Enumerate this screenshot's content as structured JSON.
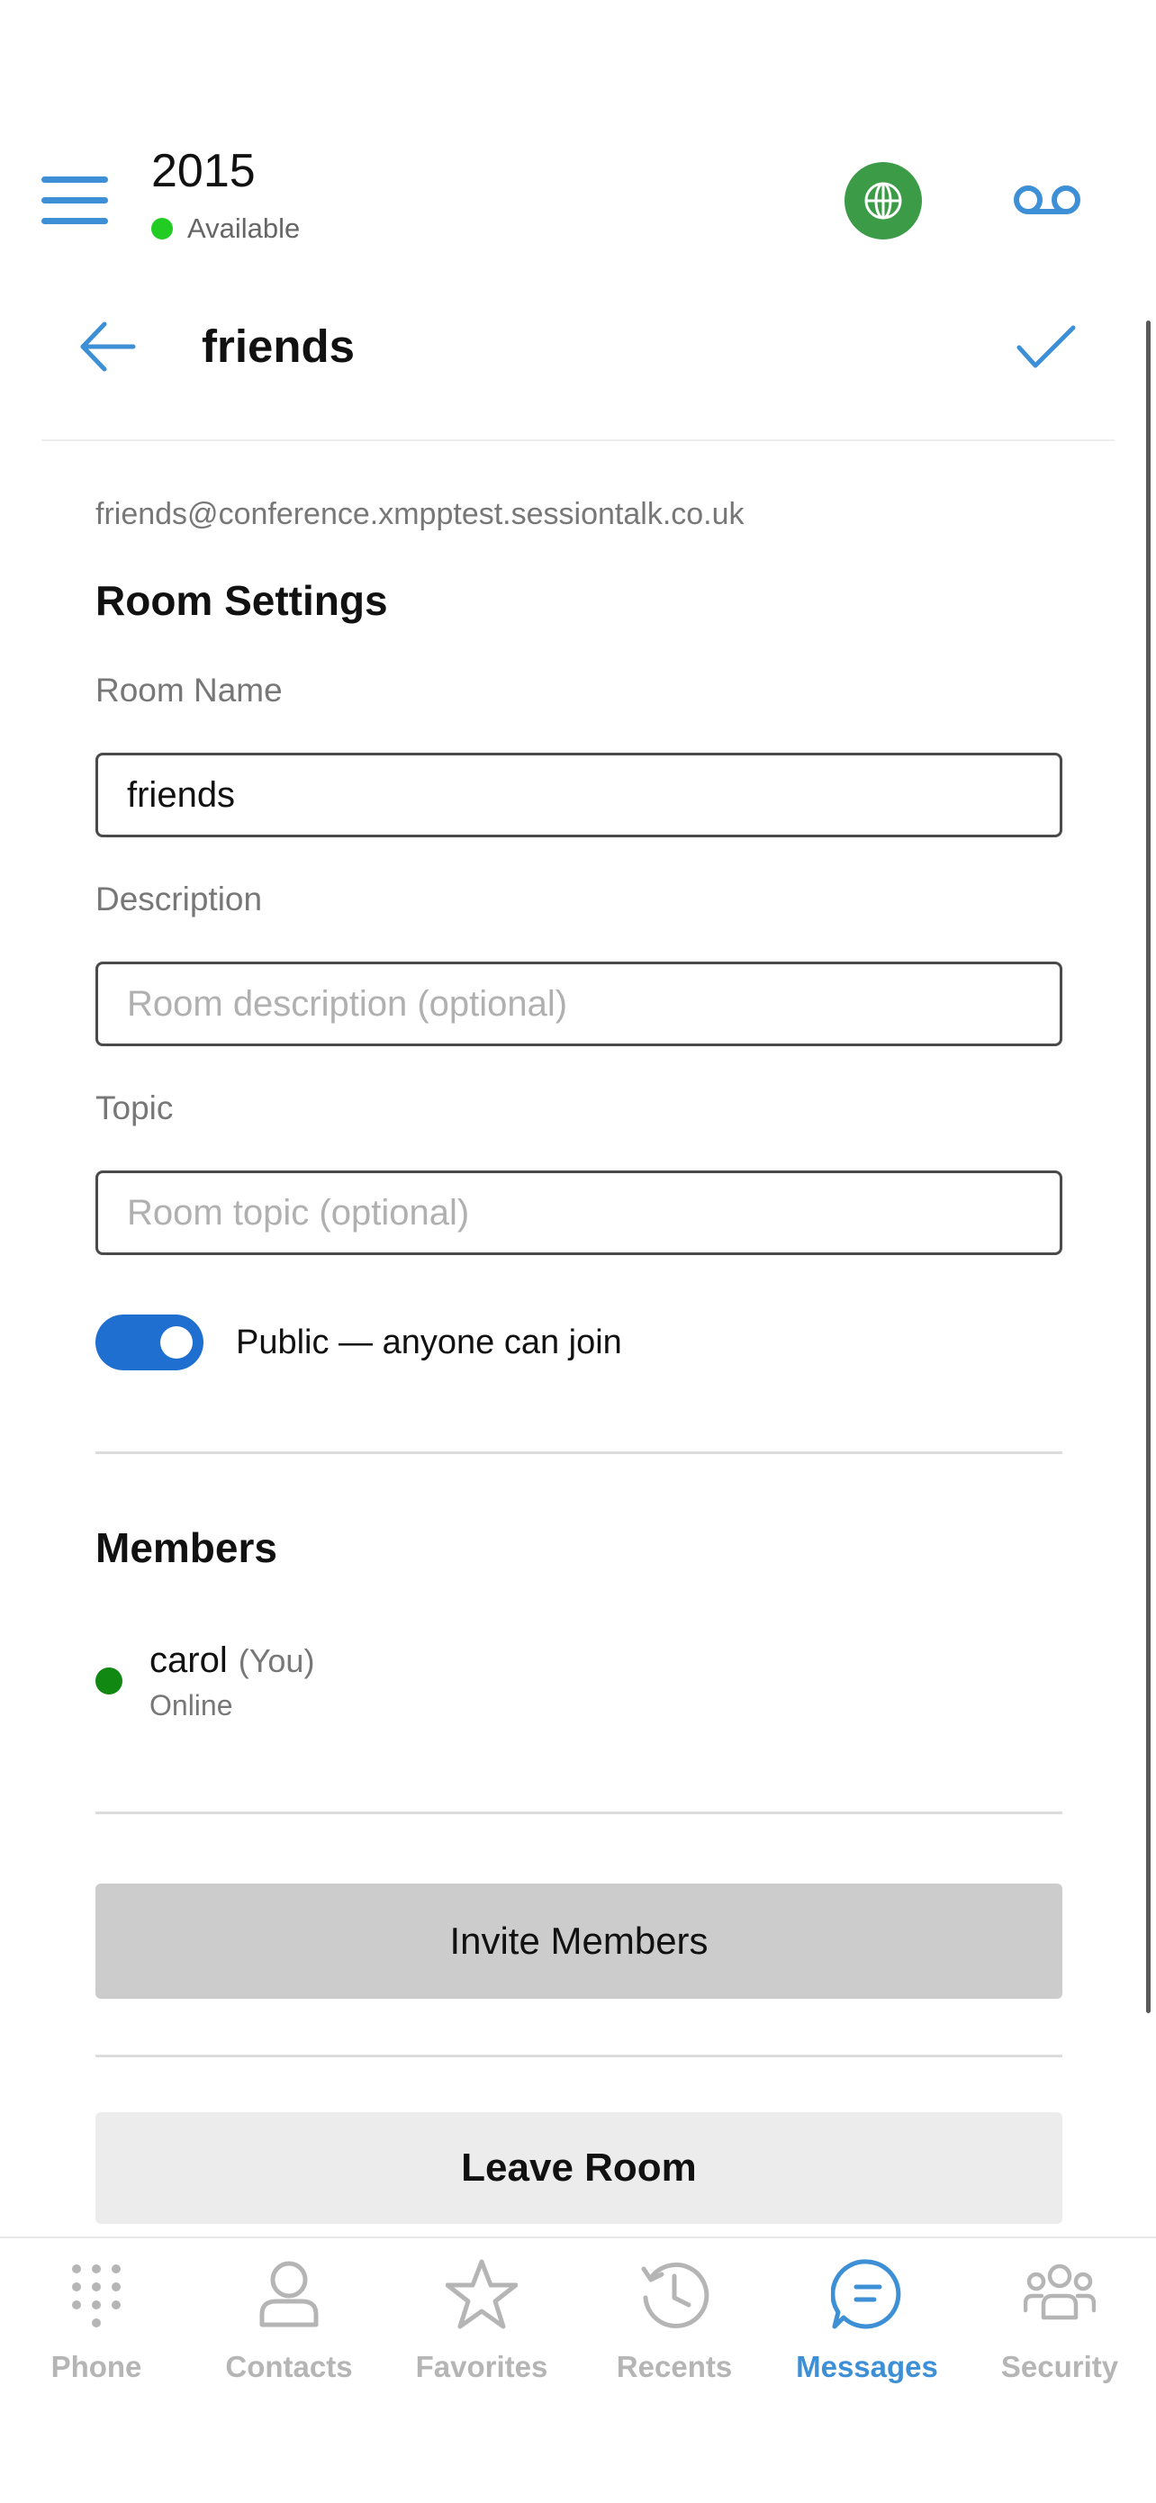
{
  "header": {
    "extension": "2015",
    "presence": "Available",
    "colors": {
      "accent": "#3d8fd6",
      "globe_bg": "#3b9b47",
      "presence": "#22cc22"
    },
    "icons": [
      "menu-icon",
      "globe-icon",
      "voicemail-icon"
    ]
  },
  "subheader": {
    "title": "friends",
    "icons": [
      "back-arrow-icon",
      "checkmark-icon"
    ]
  },
  "room": {
    "jid": "friends@conference.xmpptest.sessiontalk.co.uk",
    "settings_title": "Room Settings",
    "name_label": "Room Name",
    "name_value": "friends",
    "description_label": "Description",
    "description_placeholder": "Room description (optional)",
    "topic_label": "Topic",
    "topic_placeholder": "Room topic (optional)",
    "public_label": "Public — anyone can join",
    "public_enabled": true
  },
  "members": {
    "title": "Members",
    "list": [
      {
        "name": "carol",
        "suffix": "(You)",
        "status": "Online",
        "status_color": "#118811"
      }
    ]
  },
  "actions": {
    "invite_label": "Invite Members",
    "leave_label": "Leave Room"
  },
  "tabbar": {
    "active": "Messages",
    "tabs": [
      {
        "label": "Phone",
        "icon": "dialpad-icon"
      },
      {
        "label": "Contacts",
        "icon": "person-icon"
      },
      {
        "label": "Favorites",
        "icon": "star-icon"
      },
      {
        "label": "Recents",
        "icon": "history-icon"
      },
      {
        "label": "Messages",
        "icon": "chat-bubble-icon"
      },
      {
        "label": "Security",
        "icon": "group-icon"
      }
    ]
  }
}
